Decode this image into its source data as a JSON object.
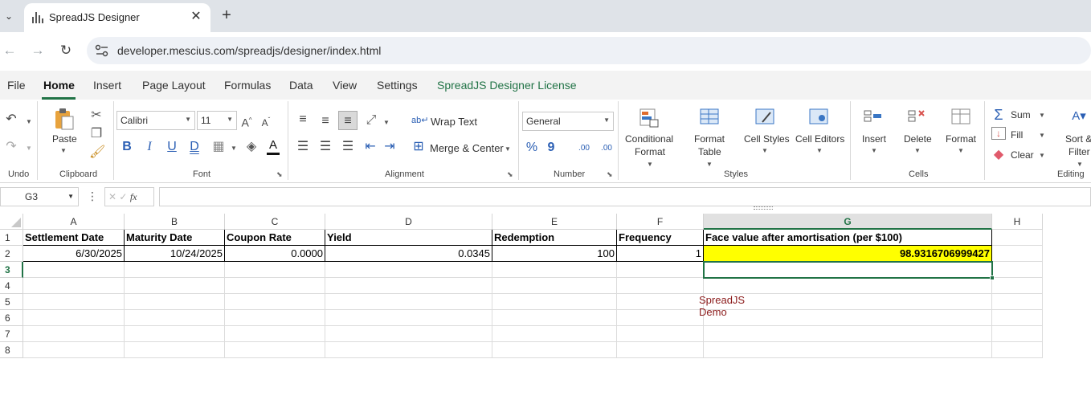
{
  "browser": {
    "tab_menu_icon": "chevron-down-icon",
    "tab_title": "SpreadJS Designer",
    "tab_close": "✕",
    "new_tab": "+",
    "url": "developer.mescius.com/spreadjs/designer/index.html",
    "back": "←",
    "forward": "→",
    "reload": "↻"
  },
  "ribbon_tabs": [
    "File",
    "Home",
    "Insert",
    "Page Layout",
    "Formulas",
    "Data",
    "View",
    "Settings",
    "SpreadJS Designer License"
  ],
  "active_tab": "Home",
  "ribbon": {
    "undo": {
      "group_label": "Undo"
    },
    "clipboard": {
      "paste_label": "Paste",
      "group_label": "Clipboard"
    },
    "font": {
      "font_name": "Calibri",
      "font_size": "11",
      "group_label": "Font",
      "bold": "B",
      "italic": "I",
      "underline": "U",
      "double_underline": "D"
    },
    "alignment": {
      "wrap_text": "Wrap Text",
      "merge_center": "Merge & Center",
      "group_label": "Alignment"
    },
    "number": {
      "format": "General",
      "percent": "%",
      "comma": "9",
      "inc_decimal": ".00",
      "dec_decimal": ".00",
      "group_label": "Number"
    },
    "styles": {
      "conditional_format_1": "Conditional",
      "conditional_format_2": "Format",
      "format_table_1": "Format",
      "format_table_2": "Table",
      "cell_styles": "Cell Styles",
      "cell_editors": "Cell Editors",
      "group_label": "Styles"
    },
    "cells": {
      "insert": "Insert",
      "delete": "Delete",
      "format": "Format",
      "group_label": "Cells"
    },
    "editing": {
      "sum": "Sum",
      "fill": "Fill",
      "clear": "Clear",
      "sort_1": "Sort &",
      "sort_2": "Filter",
      "group_label": "Editing"
    }
  },
  "formula_bar": {
    "name_box": "G3",
    "fx": "fx",
    "formula": ""
  },
  "sheet": {
    "columns": [
      "A",
      "B",
      "C",
      "D",
      "E",
      "F",
      "G",
      "H"
    ],
    "rows": [
      "1",
      "2",
      "3",
      "4",
      "5",
      "6",
      "7",
      "8"
    ],
    "selected_column": "G",
    "selected_row": "3",
    "headers": [
      "Settlement Date",
      "Maturity Date",
      "Coupon Rate",
      "Yield",
      "Redemption",
      "Frequency",
      "Face value after amortisation (per $100)"
    ],
    "values": [
      "6/30/2025",
      "10/24/2025",
      "0.0000",
      "0.0345",
      "100",
      "1",
      "98.9316706999427"
    ],
    "watermark": "SpreadJS Demo"
  },
  "colors": {
    "accent": "#217346",
    "highlight": "#ffff00",
    "watermark": "#8b1a1a",
    "license_tab": "#217346"
  }
}
